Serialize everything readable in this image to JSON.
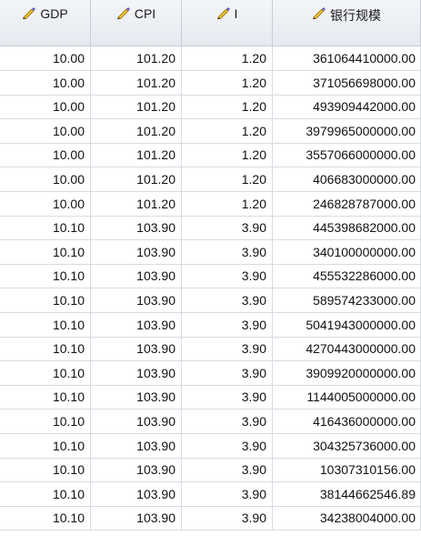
{
  "columns": [
    {
      "label": "GDP",
      "icon": "ruler-pencil-icon"
    },
    {
      "label": "CPI",
      "icon": "ruler-pencil-icon"
    },
    {
      "label": "I",
      "icon": "ruler-pencil-icon"
    },
    {
      "label": "银行规模",
      "icon": "ruler-pencil-icon"
    }
  ],
  "rows": [
    [
      "10.00",
      "101.20",
      "1.20",
      "361064410000.00"
    ],
    [
      "10.00",
      "101.20",
      "1.20",
      "371056698000.00"
    ],
    [
      "10.00",
      "101.20",
      "1.20",
      "493909442000.00"
    ],
    [
      "10.00",
      "101.20",
      "1.20",
      "3979965000000.00"
    ],
    [
      "10.00",
      "101.20",
      "1.20",
      "3557066000000.00"
    ],
    [
      "10.00",
      "101.20",
      "1.20",
      "406683000000.00"
    ],
    [
      "10.00",
      "101.20",
      "1.20",
      "246828787000.00"
    ],
    [
      "10.10",
      "103.90",
      "3.90",
      "445398682000.00"
    ],
    [
      "10.10",
      "103.90",
      "3.90",
      "340100000000.00"
    ],
    [
      "10.10",
      "103.90",
      "3.90",
      "455532286000.00"
    ],
    [
      "10.10",
      "103.90",
      "3.90",
      "589574233000.00"
    ],
    [
      "10.10",
      "103.90",
      "3.90",
      "5041943000000.00"
    ],
    [
      "10.10",
      "103.90",
      "3.90",
      "4270443000000.00"
    ],
    [
      "10.10",
      "103.90",
      "3.90",
      "3909920000000.00"
    ],
    [
      "10.10",
      "103.90",
      "3.90",
      "1144005000000.00"
    ],
    [
      "10.10",
      "103.90",
      "3.90",
      "416436000000.00"
    ],
    [
      "10.10",
      "103.90",
      "3.90",
      "304325736000.00"
    ],
    [
      "10.10",
      "103.90",
      "3.90",
      "10307310156.00"
    ],
    [
      "10.10",
      "103.90",
      "3.90",
      "38144662546.89"
    ],
    [
      "10.10",
      "103.90",
      "3.90",
      "34238004000.00"
    ]
  ]
}
